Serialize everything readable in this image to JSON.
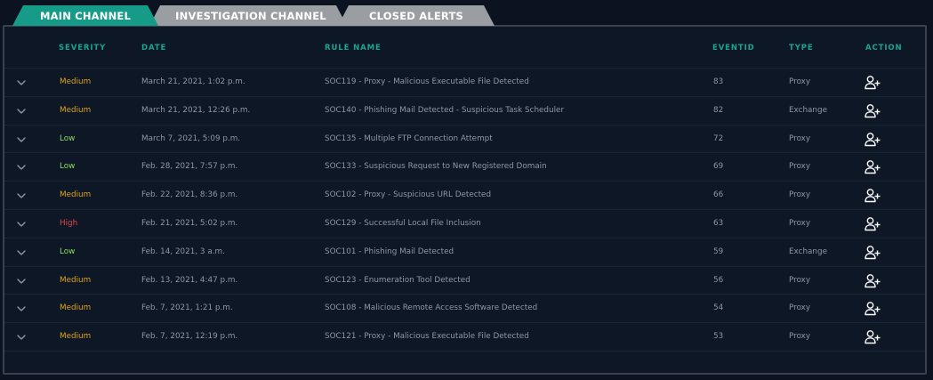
{
  "tabs": [
    {
      "label": "MAIN CHANNEL",
      "active": true
    },
    {
      "label": "INVESTIGATION CHANNEL",
      "active": false
    },
    {
      "label": "CLOSED ALERTS",
      "active": false
    }
  ],
  "columns": {
    "severity": "SEVERITY",
    "date": "DATE",
    "rule_name": "RULE NAME",
    "eventid": "EVENTID",
    "type": "TYPE",
    "action": "ACTION"
  },
  "rows": [
    {
      "severity": "Medium",
      "date": "March 21, 2021, 1:02 p.m.",
      "rule": "SOC119 - Proxy - Malicious Executable File Detected",
      "eventid": "83",
      "type": "Proxy"
    },
    {
      "severity": "Medium",
      "date": "March 21, 2021, 12:26 p.m.",
      "rule": "SOC140 - Phishing Mail Detected - Suspicious Task Scheduler",
      "eventid": "82",
      "type": "Exchange"
    },
    {
      "severity": "Low",
      "date": "March 7, 2021, 5:09 p.m.",
      "rule": "SOC135 - Multiple FTP Connection Attempt",
      "eventid": "72",
      "type": "Proxy"
    },
    {
      "severity": "Low",
      "date": "Feb. 28, 2021, 7:57 p.m.",
      "rule": "SOC133 - Suspicious Request to New Registered Domain",
      "eventid": "69",
      "type": "Proxy"
    },
    {
      "severity": "Medium",
      "date": "Feb. 22, 2021, 8:36 p.m.",
      "rule": "SOC102 - Proxy - Suspicious URL Detected",
      "eventid": "66",
      "type": "Proxy"
    },
    {
      "severity": "High",
      "date": "Feb. 21, 2021, 5:02 p.m.",
      "rule": "SOC129 - Successful Local File Inclusion",
      "eventid": "63",
      "type": "Proxy"
    },
    {
      "severity": "Low",
      "date": "Feb. 14, 2021, 3 a.m.",
      "rule": "SOC101 - Phishing Mail Detected",
      "eventid": "59",
      "type": "Exchange"
    },
    {
      "severity": "Medium",
      "date": "Feb. 13, 2021, 4:47 p.m.",
      "rule": "SOC123 - Enumeration Tool Detected",
      "eventid": "56",
      "type": "Proxy"
    },
    {
      "severity": "Medium",
      "date": "Feb. 7, 2021, 1:21 p.m.",
      "rule": "SOC108 - Malicious Remote Access Software Detected",
      "eventid": "54",
      "type": "Proxy"
    },
    {
      "severity": "Medium",
      "date": "Feb. 7, 2021, 12:19 p.m.",
      "rule": "SOC121 - Proxy - Malicious Executable File Detected",
      "eventid": "53",
      "type": "Proxy"
    }
  ],
  "icons": {
    "expand": "chevron-down-icon",
    "action": "assign-user-add-icon"
  },
  "colors": {
    "accent": "#169b89",
    "tab_inactive": "#9a9da2",
    "medium": "#e0a319",
    "low": "#8edc62",
    "high": "#e0454f",
    "background": "#0e1726"
  }
}
